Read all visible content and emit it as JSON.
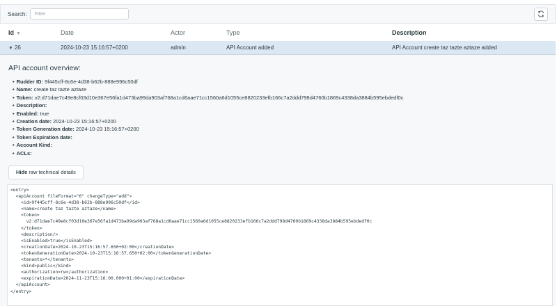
{
  "toolbar": {
    "search_label": "Search:",
    "search_placeholder": "Filter",
    "refresh_icon": "refresh-icon"
  },
  "table": {
    "headers": {
      "id": "Id",
      "date": "Date",
      "actor": "Actor",
      "type": "Type",
      "description": "Description"
    },
    "rows": [
      {
        "id": "26",
        "date": "2024-10-23 15:16:57+0200",
        "actor": "admin",
        "type": "API Account added",
        "description": "API Account create taz tazte aztaze added"
      }
    ]
  },
  "details": {
    "title": "API account overview:",
    "attributes": [
      {
        "label": "Rudder ID:",
        "value": "9f445cff-8c6e-4d38-b62b-888e996c50df"
      },
      {
        "label": "Name:",
        "value": "create taz tazte aztaze"
      },
      {
        "label": "Token:",
        "value": "v2:d71dae7c49e8cf03d10e367e56fa1d473ba99da903af768a1cd6aae71cc1560a6d1055ce8820233efb166c7a2ddd798d4760b1869c4338da3884b595ebdedf0c"
      },
      {
        "label": "Description:",
        "value": ""
      },
      {
        "label": "Enabled:",
        "value": "true"
      },
      {
        "label": "Creation date:",
        "value": "2024-10-23 15:16:57+0200"
      },
      {
        "label": "Token Generation date:",
        "value": "2024-10-23 15:16:57+0200"
      },
      {
        "label": "Token Expiration date:",
        "value": ""
      },
      {
        "label": "Account Kind:",
        "value": ""
      },
      {
        "label": "ACLs:",
        "value": ""
      }
    ],
    "raw_button_bold": "Hide",
    "raw_button_rest": " raw technical details",
    "xml": "<entry>\n  <apiAccount fileFormat=\"6\" changeType=\"add\">\n    <id>9f445cff-8c6e-4d38-b62b-888e996c50df</id>\n    <name>create taz tazte aztaze</name>\n    <token>\n      v2:d71dae7c49e8cf03d10e367e56fa1d473ba99da903af768a1cd6aae71cc1560a6d1055ce8820233efb166c7a2ddd798d4760b1869c4338da3884b595ebdedf0c\n    </token>\n    <description/>\n    <isEnabled>true</isEnabled>\n    <creationDate>2024-10-23T15:16:57.650+02:00</creationDate>\n    <tokenGenerationDate>2024-10-23T15:16:57.650+02:00</tokenGenerationDate>\n    <tenants>*</tenants>\n    <kind>public</kind>\n    <authorization>rw</authorization>\n    <expirationDate>2024-11-23T15:16:00.000+01:00</expirationDate>\n  </apiAccount>\n</entry>"
  },
  "colors": {
    "row_selected": "#dbe7f3",
    "panel_bg": "#f7f8fa",
    "text": "#2a3a40"
  }
}
